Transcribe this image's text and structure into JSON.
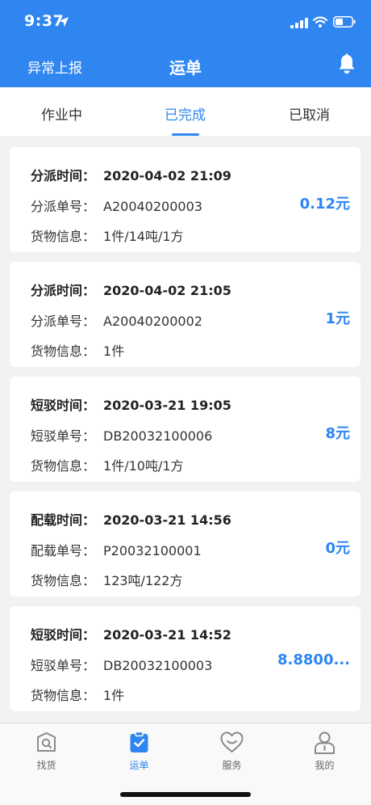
{
  "status_bar": {
    "time": "9:37"
  },
  "nav": {
    "left": "异常上报",
    "title": "运单"
  },
  "tabs": [
    "作业中",
    "已完成",
    "已取消"
  ],
  "active_tab": 1,
  "cards": [
    {
      "time_label": "分派时间：",
      "time": "2020-04-02 21:09",
      "no_label": "分派单号：",
      "no": "A20040200003",
      "goods_label": "货物信息：",
      "goods": "1件/14吨/1方",
      "price": "0.12元"
    },
    {
      "time_label": "分派时间：",
      "time": "2020-04-02 21:05",
      "no_label": "分派单号：",
      "no": "A20040200002",
      "goods_label": "货物信息：",
      "goods": "1件",
      "price": "1元"
    },
    {
      "time_label": "短驳时间：",
      "time": "2020-03-21 19:05",
      "no_label": "短驳单号：",
      "no": "DB20032100006",
      "goods_label": "货物信息：",
      "goods": "1件/10吨/1方",
      "price": "8元"
    },
    {
      "time_label": "配载时间：",
      "time": "2020-03-21 14:56",
      "no_label": "配载单号：",
      "no": "P20032100001",
      "goods_label": "货物信息：",
      "goods": "123吨/122方",
      "price": "0元"
    },
    {
      "time_label": "短驳时间：",
      "time": "2020-03-21 14:52",
      "no_label": "短驳单号：",
      "no": "DB20032100003",
      "goods_label": "货物信息：",
      "goods": "1件",
      "price": "8.8800..."
    }
  ],
  "tabbar": [
    {
      "label": "找货",
      "icon": "search-goods-icon"
    },
    {
      "label": "运单",
      "icon": "waybill-icon"
    },
    {
      "label": "服务",
      "icon": "service-heart-icon"
    },
    {
      "label": "我的",
      "icon": "profile-icon"
    }
  ],
  "active_tabbar": 1,
  "colors": {
    "primary": "#2f86f0",
    "background": "#f2f2f4",
    "text": "#333333"
  }
}
